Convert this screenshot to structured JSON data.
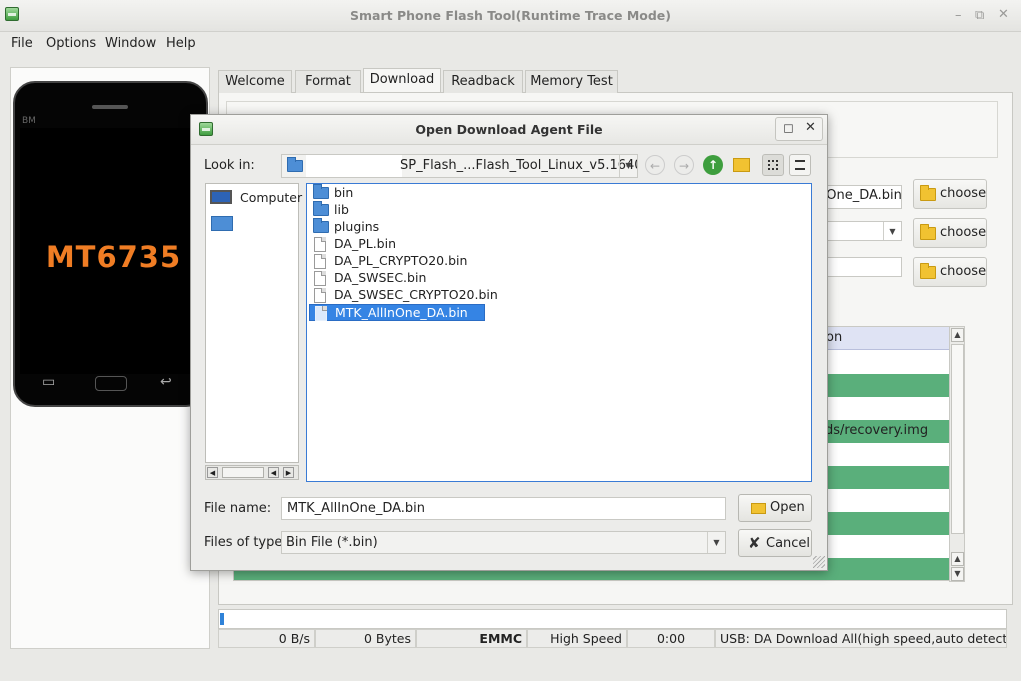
{
  "window": {
    "title": "Smart Phone Flash Tool(Runtime Trace Mode)"
  },
  "menu": [
    "File",
    "Options",
    "Window",
    "Help"
  ],
  "phone": {
    "brand_text": "BM",
    "chip": "MT6735"
  },
  "tabs": [
    "Welcome",
    "Format",
    "Download",
    "Readback",
    "Memory Test"
  ],
  "download": {
    "da_field_value": "nOne_DA.bin",
    "scatter_field_value": "",
    "auth_field_value": "",
    "choose_label": "choose"
  },
  "table": {
    "header_visible": "on",
    "recovery_location": "ads/recovery.img",
    "row_colors": [
      "white",
      "green",
      "white",
      "green",
      "white",
      "green",
      "white",
      "green",
      "white",
      "green"
    ]
  },
  "status": {
    "speed": "0 B/s",
    "bytes": "0 Bytes",
    "storage": "EMMC",
    "mode": "High Speed",
    "time": "0:00",
    "usb": "USB: DA Download All(high speed,auto detect)"
  },
  "dialog": {
    "title": "Open Download Agent File",
    "look_in_label": "Look in:",
    "look_in_value": "SP_Flash_...Flash_Tool_Linux_v5.1640",
    "places": [
      "Computer"
    ],
    "files": [
      {
        "name": "bin",
        "type": "folder",
        "selected": false
      },
      {
        "name": "lib",
        "type": "folder",
        "selected": false
      },
      {
        "name": "plugins",
        "type": "folder",
        "selected": false
      },
      {
        "name": "DA_PL.bin",
        "type": "file",
        "selected": false
      },
      {
        "name": "DA_PL_CRYPTO20.bin",
        "type": "file",
        "selected": false
      },
      {
        "name": "DA_SWSEC.bin",
        "type": "file",
        "selected": false
      },
      {
        "name": "DA_SWSEC_CRYPTO20.bin",
        "type": "file",
        "selected": false
      },
      {
        "name": "MTK_AllInOne_DA.bin",
        "type": "file",
        "selected": true
      }
    ],
    "file_name_label": "File name:",
    "file_name_value": "MTK_AllInOne_DA.bin",
    "file_type_label": "Files of type:",
    "file_type_value": "Bin File (*.bin)",
    "open_label": "Open",
    "cancel_label": "Cancel"
  },
  "colors": {
    "selection": "#3584e4",
    "table_green": "#5aaf7b",
    "chip_text": "#f07d24"
  }
}
